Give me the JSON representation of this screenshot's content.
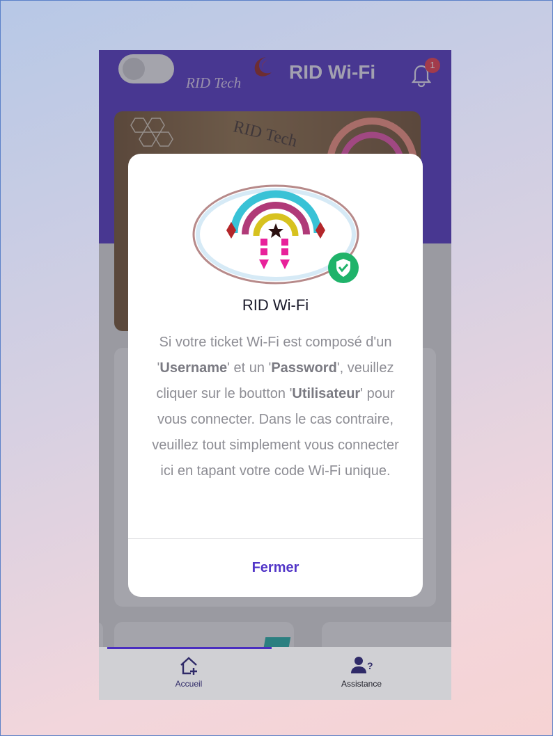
{
  "header": {
    "brand": "RID Tech",
    "title": "RID Wi-Fi",
    "notification_count": "1",
    "dark_mode_toggle": "off"
  },
  "banner": {
    "text": "RID Tech"
  },
  "bottom_nav": {
    "items": [
      {
        "label": "Accueil",
        "icon": "home-plus-icon",
        "active": true
      },
      {
        "label": "Assistance",
        "icon": "user-question-icon",
        "active": false
      }
    ]
  },
  "modal": {
    "title": "RID Wi-Fi",
    "body": {
      "p1": "Si votre ticket Wi-Fi est composé d'un '",
      "b1": "Username",
      "p2": "' et un '",
      "b2": "Password",
      "p3": "', veuillez cliquer sur le boutton '",
      "b3": "Utilisateur",
      "p4": "' pour vous connecter. Dans le cas contraire, veuillez tout simplement vous connecter ici en tapant votre code Wi-Fi unique."
    },
    "close_label": "Fermer",
    "verified_icon": "shield-check-icon"
  },
  "colors": {
    "primary": "#4a2ec0",
    "accent_text": "#5236c8",
    "verified": "#1fb36a",
    "badge": "#e53448"
  }
}
